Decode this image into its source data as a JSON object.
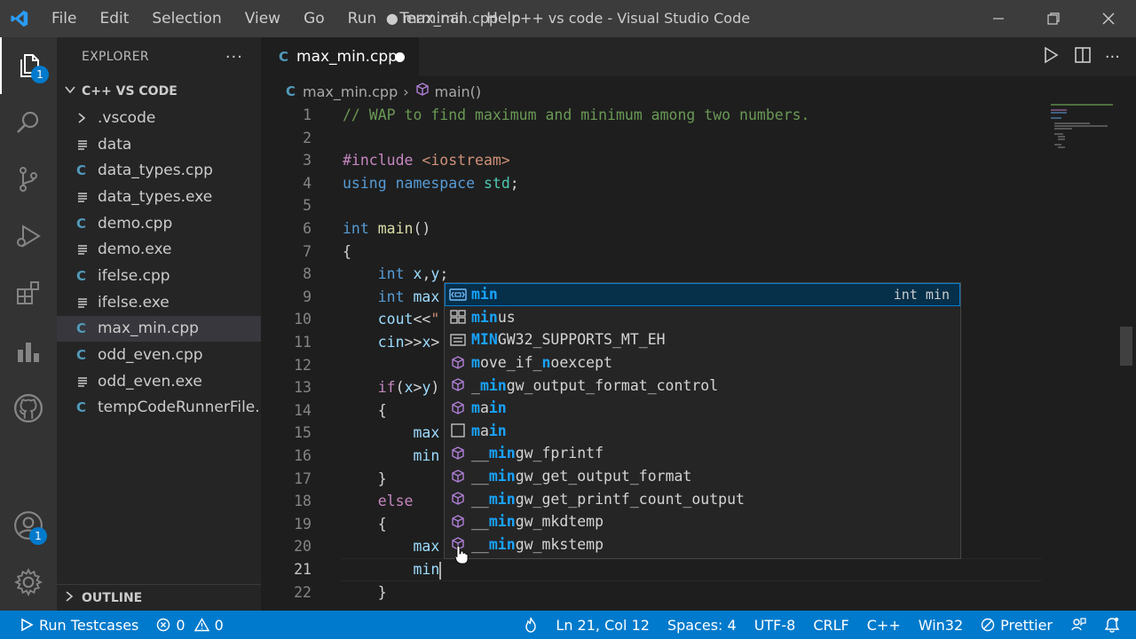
{
  "titlebar": {
    "menu": [
      "File",
      "Edit",
      "Selection",
      "View",
      "Go",
      "Run",
      "Terminal",
      "Help"
    ],
    "title": "● max_min.cpp - c++ vs code - Visual Studio Code"
  },
  "activitybar": {
    "explorer_badge": "1",
    "accounts_badge": "1"
  },
  "sidebar": {
    "title": "EXPLORER",
    "more": "···",
    "folder": "C++ VS CODE",
    "files": [
      {
        "name": ".vscode",
        "kind": "folder"
      },
      {
        "name": "data",
        "kind": "text"
      },
      {
        "name": "data_types.cpp",
        "kind": "cpp"
      },
      {
        "name": "data_types.exe",
        "kind": "text"
      },
      {
        "name": "demo.cpp",
        "kind": "cpp"
      },
      {
        "name": "demo.exe",
        "kind": "text"
      },
      {
        "name": "ifelse.cpp",
        "kind": "cpp"
      },
      {
        "name": "ifelse.exe",
        "kind": "text"
      },
      {
        "name": "max_min.cpp",
        "kind": "cpp",
        "selected": true
      },
      {
        "name": "odd_even.cpp",
        "kind": "cpp"
      },
      {
        "name": "odd_even.exe",
        "kind": "text"
      },
      {
        "name": "tempCodeRunnerFile....",
        "kind": "cpp"
      }
    ],
    "outline": "OUTLINE"
  },
  "tab": {
    "label": "max_min.cpp"
  },
  "breadcrumb": {
    "file": "max_min.cpp",
    "sep": "›",
    "symbol": "main()"
  },
  "editor": {
    "current_line": 21,
    "lines": [
      {
        "n": "1",
        "tokens": [
          [
            "cmt",
            "// WAP to find maximum and minimum among two numbers."
          ]
        ]
      },
      {
        "n": "2",
        "tokens": []
      },
      {
        "n": "3",
        "tokens": [
          [
            "pp",
            "#include "
          ],
          [
            "str",
            "<iostream>"
          ]
        ]
      },
      {
        "n": "4",
        "tokens": [
          [
            "kw",
            "using "
          ],
          [
            "kw",
            "namespace "
          ],
          [
            "ty",
            "std"
          ],
          [
            "plain",
            ";"
          ]
        ]
      },
      {
        "n": "5",
        "tokens": []
      },
      {
        "n": "6",
        "tokens": [
          [
            "kw",
            "int "
          ],
          [
            "fn",
            "main"
          ],
          [
            "plain",
            "()"
          ]
        ]
      },
      {
        "n": "7",
        "tokens": [
          [
            "plain",
            "{"
          ]
        ]
      },
      {
        "n": "8",
        "tokens": [
          [
            "plain",
            "    "
          ],
          [
            "kw",
            "int "
          ],
          [
            "var",
            "x"
          ],
          [
            "plain",
            ","
          ],
          [
            "var",
            "y"
          ],
          [
            "plain",
            ";"
          ]
        ]
      },
      {
        "n": "9",
        "tokens": [
          [
            "plain",
            "    "
          ],
          [
            "kw",
            "int "
          ],
          [
            "var",
            "max"
          ]
        ]
      },
      {
        "n": "10",
        "tokens": [
          [
            "plain",
            "    "
          ],
          [
            "var",
            "cout"
          ],
          [
            "plain",
            "<<"
          ],
          [
            "str",
            "\""
          ]
        ]
      },
      {
        "n": "11",
        "tokens": [
          [
            "plain",
            "    "
          ],
          [
            "var",
            "cin"
          ],
          [
            "plain",
            ">>"
          ],
          [
            "var",
            "x"
          ],
          [
            "plain",
            ">"
          ]
        ]
      },
      {
        "n": "12",
        "tokens": []
      },
      {
        "n": "13",
        "tokens": [
          [
            "plain",
            "    "
          ],
          [
            "pp",
            "if"
          ],
          [
            "plain",
            "("
          ],
          [
            "var",
            "x"
          ],
          [
            "plain",
            ">"
          ],
          [
            "var",
            "y"
          ],
          [
            "plain",
            ")"
          ]
        ]
      },
      {
        "n": "14",
        "tokens": [
          [
            "plain",
            "    {"
          ]
        ]
      },
      {
        "n": "15",
        "tokens": [
          [
            "plain",
            "        "
          ],
          [
            "var",
            "max"
          ]
        ]
      },
      {
        "n": "16",
        "tokens": [
          [
            "plain",
            "        "
          ],
          [
            "var",
            "min"
          ]
        ]
      },
      {
        "n": "17",
        "tokens": [
          [
            "plain",
            "    }"
          ]
        ]
      },
      {
        "n": "18",
        "tokens": [
          [
            "plain",
            "    "
          ],
          [
            "pp",
            "else"
          ]
        ]
      },
      {
        "n": "19",
        "tokens": [
          [
            "plain",
            "    {"
          ]
        ]
      },
      {
        "n": "20",
        "tokens": [
          [
            "plain",
            "        "
          ],
          [
            "var",
            "max"
          ]
        ]
      },
      {
        "n": "21",
        "tokens": [
          [
            "plain",
            "        "
          ],
          [
            "var",
            "min"
          ]
        ]
      },
      {
        "n": "22",
        "tokens": [
          [
            "plain",
            "    }"
          ]
        ]
      }
    ]
  },
  "suggest": {
    "items": [
      {
        "label": "min",
        "match": 3,
        "icon": "variable",
        "detail": "int min",
        "selected": true
      },
      {
        "label": "minus",
        "match": 3,
        "icon": "struct"
      },
      {
        "label": "MINGW32_SUPPORTS_MT_EH",
        "match": 3,
        "icon": "constant"
      },
      {
        "label": "move_if_noexcept",
        "match": 0,
        "icon": "method",
        "spans": [
          [
            0,
            1
          ],
          [
            8,
            9
          ]
        ]
      },
      {
        "label": "_mingw_output_format_control",
        "match": 0,
        "icon": "method",
        "spans": [
          [
            1,
            4
          ]
        ]
      },
      {
        "label": "main",
        "match": 0,
        "icon": "method",
        "spans": [
          [
            0,
            1
          ],
          [
            2,
            4
          ]
        ]
      },
      {
        "label": "main",
        "match": 0,
        "icon": "text",
        "spans": [
          [
            0,
            1
          ],
          [
            2,
            4
          ]
        ]
      },
      {
        "label": "__mingw_fprintf",
        "match": 0,
        "icon": "method",
        "spans": [
          [
            2,
            5
          ]
        ]
      },
      {
        "label": "__mingw_get_output_format",
        "match": 0,
        "icon": "method",
        "spans": [
          [
            2,
            5
          ]
        ]
      },
      {
        "label": "__mingw_get_printf_count_output",
        "match": 0,
        "icon": "method",
        "spans": [
          [
            2,
            5
          ]
        ]
      },
      {
        "label": "__mingw_mkdtemp",
        "match": 0,
        "icon": "method",
        "spans": [
          [
            2,
            5
          ]
        ]
      },
      {
        "label": "__mingw_mkstemp",
        "match": 0,
        "icon": "method",
        "spans": [
          [
            2,
            5
          ]
        ]
      }
    ]
  },
  "statusbar": {
    "run": "Run Testcases",
    "errors": "0",
    "warnings": "0",
    "position": "Ln 21, Col 12",
    "spaces": "Spaces: 4",
    "encoding": "UTF-8",
    "eol": "CRLF",
    "language": "C++",
    "platform": "Win32",
    "prettier": "Prettier"
  },
  "colors": {
    "accent": "#007acc",
    "match": "#18a3ff",
    "method_icon": "#b180d7"
  }
}
